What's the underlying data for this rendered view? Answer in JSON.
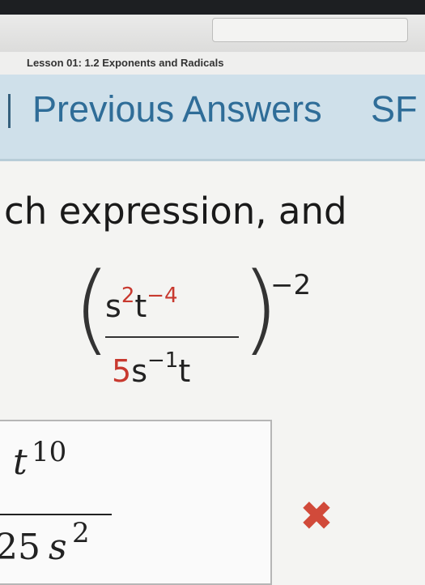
{
  "lesson": {
    "title": "Lesson 01: 1.2 Exponents and Radicals"
  },
  "tabs": {
    "previous_answers": "Previous Answers",
    "partial_next": "SF"
  },
  "question": {
    "instruction_fragment": "ch expression, and"
  },
  "expression": {
    "numerator": {
      "base1": "s",
      "exp1": "2",
      "base2": "t",
      "exp2": "−4"
    },
    "denominator": {
      "coef": "5",
      "base1": "s",
      "exp1": "−1",
      "base2": "t"
    },
    "outer_exponent": "−2",
    "open_paren": "(",
    "close_paren": ")"
  },
  "answer": {
    "numerator_var": "t",
    "numerator_exp": "10",
    "denominator_coef": "25",
    "denominator_var": "s",
    "denominator_exp": "2",
    "status_icon": "x-mark-icon"
  },
  "colors": {
    "accent_blue": "#2f6d98",
    "header_bg": "#cfe0ea",
    "incorrect_red": "#d14a3a",
    "highlight_red": "#c8392f"
  }
}
